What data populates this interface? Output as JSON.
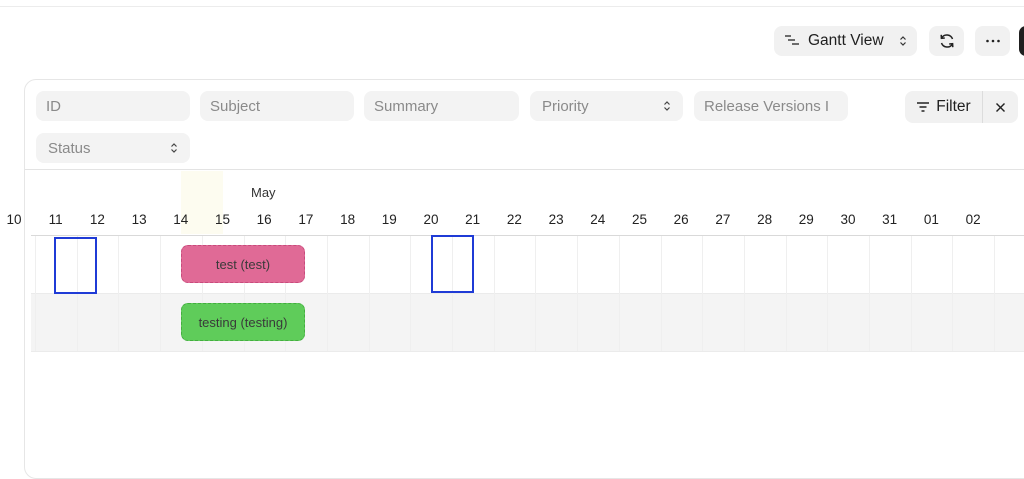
{
  "toolbar": {
    "view_label": "Gantt View"
  },
  "filters": {
    "fields": [
      {
        "key": "id",
        "placeholder": "ID"
      },
      {
        "key": "subject",
        "placeholder": "Subject"
      },
      {
        "key": "summary",
        "placeholder": "Summary"
      },
      {
        "key": "priority",
        "placeholder": "Priority"
      },
      {
        "key": "release_versions",
        "placeholder": "Release Versions I"
      },
      {
        "key": "status",
        "placeholder": "Status"
      }
    ],
    "filter_label": "Filter"
  },
  "gantt": {
    "month": "May",
    "days": [
      "10",
      "11",
      "12",
      "13",
      "14",
      "15",
      "16",
      "17",
      "18",
      "19",
      "20",
      "21",
      "22",
      "23",
      "24",
      "25",
      "26",
      "27",
      "28",
      "29",
      "30",
      "31",
      "01",
      "02"
    ],
    "bars": [
      {
        "label": "test (test)",
        "color": "#e06a96"
      },
      {
        "label": "testing (testing)",
        "color": "#5fcc5a"
      }
    ]
  },
  "colors": {
    "selection": "#1f3bd6",
    "today_highlight": "#fdfcf0"
  }
}
